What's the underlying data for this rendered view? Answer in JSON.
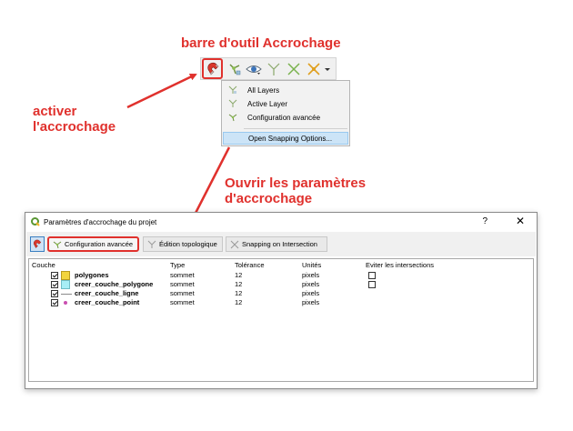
{
  "annotations": {
    "toolbar_title": "barre d'outil Accrochage",
    "activate_line1": "activer",
    "activate_line2": "l'accrochage",
    "open_line1": "Ouvrir les paramètres",
    "open_line2": "d'accrochage"
  },
  "toolbar": {
    "icons": [
      "magnet-icon",
      "snapping-mode-icon",
      "eye-icon",
      "vertex-icon",
      "segment-icon",
      "intersection-icon",
      "dropdown-arrow-icon"
    ]
  },
  "menu": {
    "items": [
      {
        "label": "All Layers",
        "icon": "all-layers-icon"
      },
      {
        "label": "Active Layer",
        "icon": "active-layer-icon"
      },
      {
        "label": "Configuration avancée",
        "icon": "advanced-config-icon"
      },
      {
        "label": "Open Snapping Options...",
        "highlighted": true
      }
    ]
  },
  "dialog": {
    "title": "Paramètres d'accrochage du projet",
    "help": "?",
    "close": "✕",
    "toolbar": {
      "config": "Configuration avancée",
      "topo": "Édition topologique",
      "intersection": "Snapping on Intersection"
    },
    "columns": {
      "layer": "Couche",
      "type": "Type",
      "tolerance": "Tolérance",
      "units": "Unités",
      "avoid": "Eviter les intersections"
    },
    "rows": [
      {
        "name": "polygones",
        "type": "sommet",
        "tolerance": "12",
        "units": "pixels",
        "checked": true,
        "avoid": false,
        "symbol": "polygon-yellow",
        "color": "#f2d43c"
      },
      {
        "name": "creer_couche_polygone",
        "type": "sommet",
        "tolerance": "12",
        "units": "pixels",
        "checked": true,
        "avoid": false,
        "symbol": "polygon-cyan",
        "color": "#a7eef6"
      },
      {
        "name": "creer_couche_ligne",
        "type": "sommet",
        "tolerance": "12",
        "units": "pixels",
        "checked": true,
        "symbol": "line",
        "color": "#8a8a8a"
      },
      {
        "name": "creer_couche_point",
        "type": "sommet",
        "tolerance": "12",
        "units": "pixels",
        "checked": true,
        "symbol": "point",
        "color": "#c94fb0"
      }
    ]
  },
  "colors": {
    "annotation_red": "#e0312d",
    "highlight": "#cce4f7",
    "qgis_green": "#589632"
  }
}
